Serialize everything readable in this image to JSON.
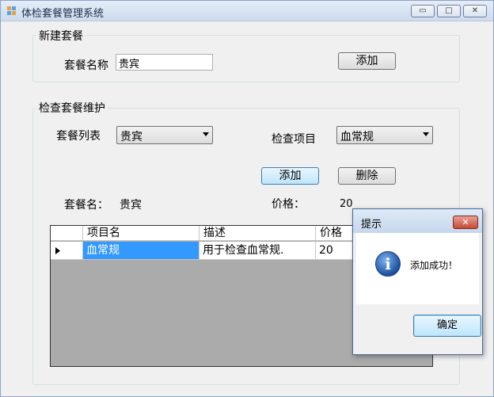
{
  "window": {
    "title": "体检套餐管理系统",
    "controls": {
      "minimize": "▭",
      "maximize": "□",
      "close": "✕"
    }
  },
  "new_package": {
    "group_title": "新建套餐",
    "name_label": "套餐名称",
    "name_value": "贵宾",
    "add_label": "添加"
  },
  "maintain": {
    "group_title": "检查套餐维护",
    "list_label": "套餐列表",
    "list_selected": "贵宾",
    "item_label": "检查项目",
    "item_selected": "血常规",
    "add_label": "添加",
    "delete_label": "删除",
    "package_name_label": "套餐名：",
    "package_name_value": "贵宾",
    "price_label": "价格：",
    "price_value": "20"
  },
  "grid": {
    "columns": [
      "项目名",
      "描述",
      "价格"
    ],
    "rows": [
      {
        "name": "血常规",
        "desc": "用于检查血常规.",
        "price": "20"
      }
    ]
  },
  "dialog": {
    "title": "提示",
    "close": "✕",
    "icon": "info-icon",
    "message": "添加成功！",
    "ok_label": "确定"
  }
}
